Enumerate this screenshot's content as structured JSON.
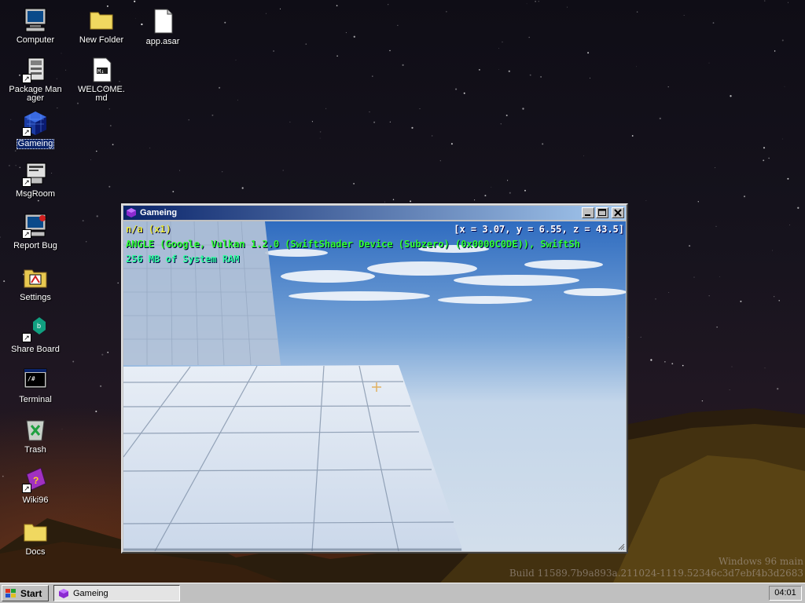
{
  "desktop": {
    "icons": [
      {
        "label": "Computer",
        "icon": "computer-icon"
      },
      {
        "label": "Package Manager",
        "icon": "package-manager-icon"
      },
      {
        "label": "Gameing",
        "icon": "cube-icon"
      },
      {
        "label": "MsgRoom",
        "icon": "msgroom-icon"
      },
      {
        "label": "Report Bug",
        "icon": "report-bug-icon"
      },
      {
        "label": "Settings",
        "icon": "settings-icon"
      },
      {
        "label": "Share Board",
        "icon": "share-board-icon"
      },
      {
        "label": "Terminal",
        "icon": "terminal-icon"
      },
      {
        "label": "Trash",
        "icon": "trash-icon"
      },
      {
        "label": "Wiki96",
        "icon": "wiki-book-icon"
      },
      {
        "label": "Docs",
        "icon": "folder-icon"
      },
      {
        "label": "New Folder",
        "icon": "folder-icon"
      },
      {
        "label": "WELCOME.md",
        "icon": "markdown-file-icon"
      },
      {
        "label": "app.asar",
        "icon": "file-icon"
      }
    ],
    "watermark": {
      "line1": "Windows 96 main",
      "line2": "Build 11589.7b9a893a.211024-1119.52346c3d7ebf4b3d2683"
    }
  },
  "window": {
    "title": "Gameing",
    "buttons": {
      "minimize": "minimize",
      "maximize": "maximize",
      "close": "close"
    },
    "hud": {
      "renderer_label": "n/a (x1)",
      "coords": "[x = 3.07, y = 6.55, z = 43.5]",
      "gpu": "ANGLE (Google, Vulkan 1.2.0 (SwiftShader Device (Subzero) (0x0000C0DE)), SwiftSh",
      "ram": "256 MB of System RAM"
    }
  },
  "taskbar": {
    "start_label": "Start",
    "task_item": "Gameing",
    "clock": "04:01"
  },
  "colors": {
    "titlebar_start": "#0a246a",
    "titlebar_end": "#a6caf0",
    "hud_yellow": "#e8e840",
    "hud_green": "#30ff30",
    "taskbar": "#c0c0c0"
  }
}
